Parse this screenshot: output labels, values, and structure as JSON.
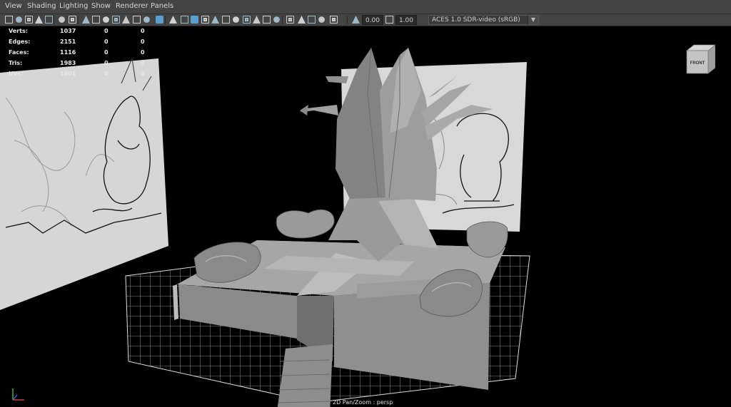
{
  "menu": [
    "View",
    "Shading",
    "Lighting",
    "Show",
    "Renderer",
    "Panels"
  ],
  "toolbar": {
    "exposure": "0.00",
    "gamma": "1.00",
    "color_space": "ACES 1.0 SDR-video (sRGB)",
    "icons": [
      "camera-select-icon",
      "camera-attributes-icon",
      "bookmarks-icon",
      "image-plane-icon",
      "2d-pan-zoom-icon",
      "grease-pencil-icon",
      "grid-icon",
      "film-gate-icon",
      "resolution-gate-icon",
      "gate-mask-icon",
      "field-chart-icon",
      "safe-action-icon",
      "safe-title-icon",
      "wireframe-icon",
      "smooth-shade-icon",
      "use-default-material-icon",
      "wireframe-on-shaded-icon",
      "xray-icon",
      "xray-joints-icon",
      "xray-components-icon",
      "use-all-lights-icon",
      "shadows-icon",
      "ambient-occlusion-icon",
      "motion-blur-icon",
      "anti-aliasing-icon",
      "depth-of-field-icon",
      "isolate-select-icon",
      "textured-icon",
      "hud-icon",
      "xray-active-icon",
      "exposure-icon",
      "gamma-icon",
      "color-management-icon",
      "dropdown-arrow-icon"
    ]
  },
  "hud": {
    "rows": [
      {
        "label": "Verts:",
        "v1": "1037",
        "v2": "0",
        "v3": "0"
      },
      {
        "label": "Edges:",
        "v1": "2151",
        "v2": "0",
        "v3": "0"
      },
      {
        "label": "Faces:",
        "v1": "1116",
        "v2": "0",
        "v3": "0"
      },
      {
        "label": "Tris:",
        "v1": "1983",
        "v2": "0",
        "v3": "0"
      },
      {
        "label": "UVs:",
        "v1": "1601",
        "v2": "0",
        "v3": "0"
      }
    ]
  },
  "viewcube": {
    "face_label": "FRONT"
  },
  "camera": {
    "label": "2D Pan/Zoom : persp"
  },
  "colors": {
    "ui_bg": "#444444",
    "viewport_bg": "#000000",
    "grid": "#ffffff",
    "mesh": "#8c8c8c",
    "accent": "#5aa0d0"
  }
}
